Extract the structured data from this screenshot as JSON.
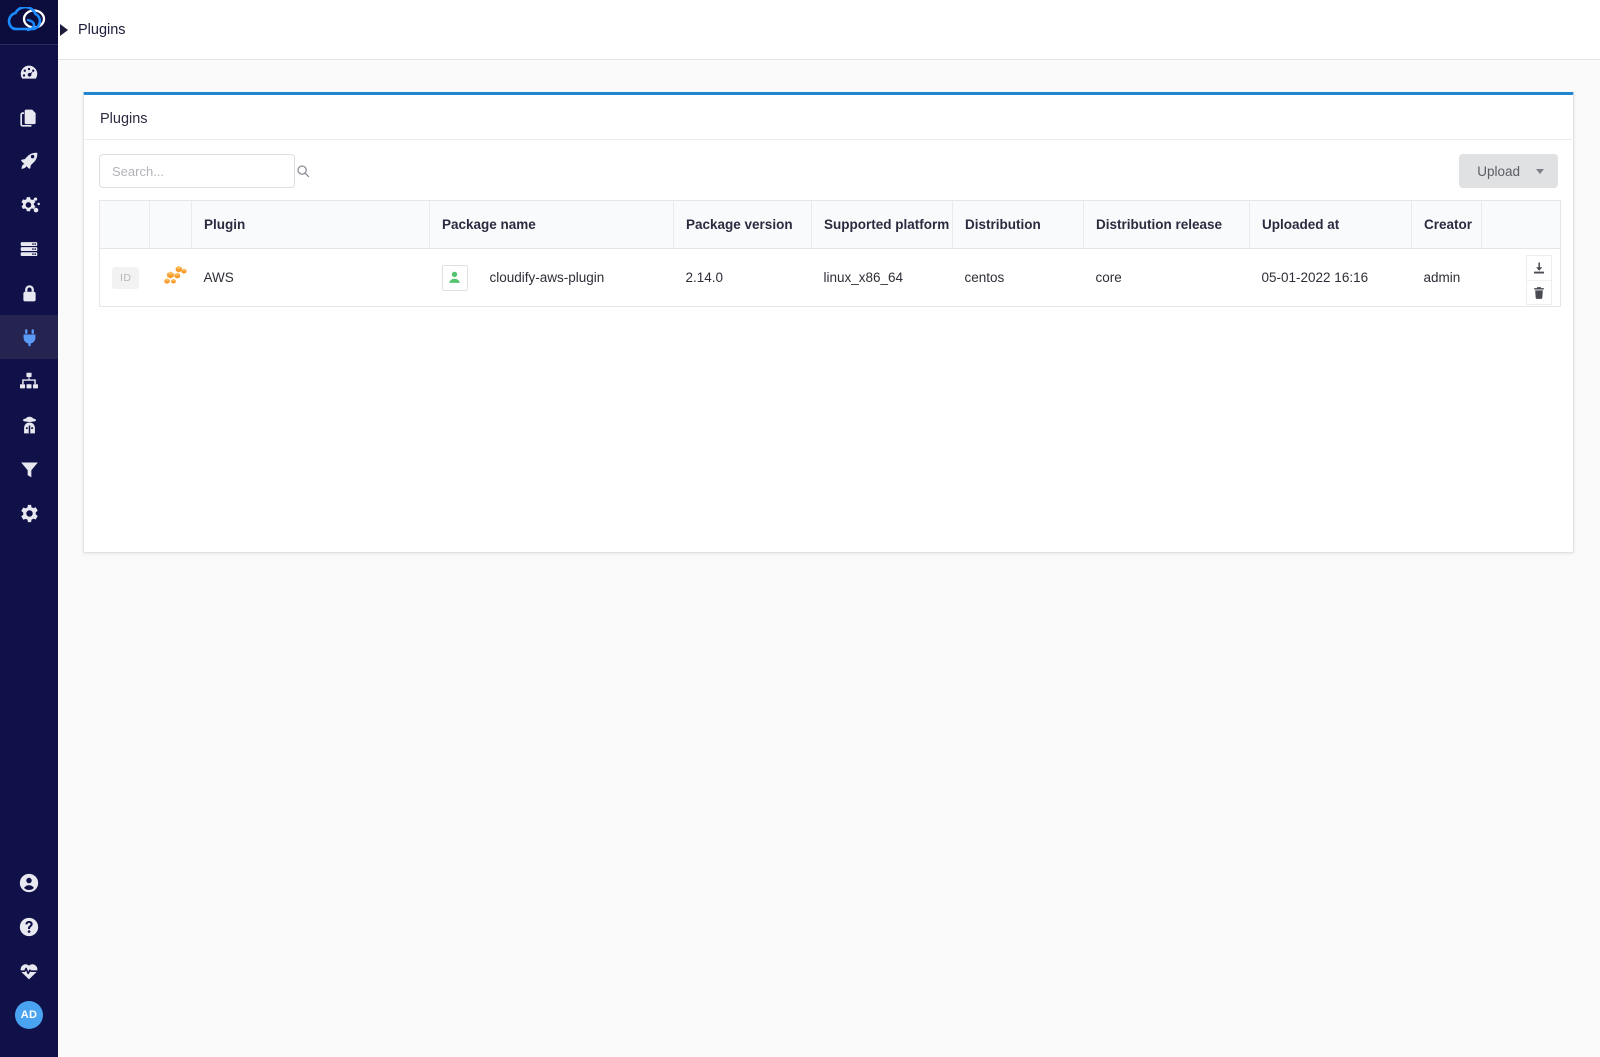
{
  "app": {
    "logo_icon": "cloudify-cloud-logo",
    "user_initials": "AD"
  },
  "sidebar": {
    "items": [
      {
        "icon": "dashboard-gauge-icon",
        "name": "dashboard",
        "active": false
      },
      {
        "icon": "blueprints-pages-icon",
        "name": "blueprints",
        "active": false
      },
      {
        "icon": "deployments-rocket-icon",
        "name": "deployments",
        "active": false
      },
      {
        "icon": "executions-gears-icon",
        "name": "executions",
        "active": false
      },
      {
        "icon": "system-resources-server-icon",
        "name": "system-resources",
        "active": false
      },
      {
        "icon": "secrets-lock-icon",
        "name": "secrets",
        "active": false
      },
      {
        "icon": "plugins-plug-icon",
        "name": "plugins",
        "active": true
      },
      {
        "icon": "sites-sitemap-icon",
        "name": "sites",
        "active": false
      },
      {
        "icon": "agents-detective-icon",
        "name": "agents",
        "active": false
      },
      {
        "icon": "filters-funnel-icon",
        "name": "filters",
        "active": false
      },
      {
        "icon": "settings-gear-icon",
        "name": "settings",
        "active": false
      }
    ],
    "bottom_items": [
      {
        "icon": "user-profile-icon",
        "name": "user-profile"
      },
      {
        "icon": "help-question-icon",
        "name": "help"
      },
      {
        "icon": "health-heartbeat-icon",
        "name": "system-health"
      }
    ]
  },
  "topbar": {
    "breadcrumb": "Plugins"
  },
  "card": {
    "title": "Plugins"
  },
  "search": {
    "placeholder": "Search...",
    "value": "",
    "icon": "search-icon"
  },
  "upload": {
    "label": "Upload",
    "caret_icon": "chevron-down-icon"
  },
  "table": {
    "columns": [
      {
        "label": "",
        "key": "id_chip"
      },
      {
        "label": "",
        "key": "plugin_icon"
      },
      {
        "label": "Plugin",
        "key": "plugin"
      },
      {
        "label": "Package name",
        "key": "package_name"
      },
      {
        "label": "Package version",
        "key": "package_version"
      },
      {
        "label": "Supported platform",
        "key": "supported_platform"
      },
      {
        "label": "Distribution",
        "key": "distribution"
      },
      {
        "label": "Distribution release",
        "key": "distribution_release"
      },
      {
        "label": "Uploaded at",
        "key": "uploaded_at"
      },
      {
        "label": "Creator",
        "key": "creator"
      },
      {
        "label": "",
        "key": "actions"
      }
    ],
    "rows": [
      {
        "id_chip": "ID",
        "plugin_icon": "aws-cubes-icon",
        "plugin": "AWS",
        "package_icon": "user-green-icon",
        "package_name": "cloudify-aws-plugin",
        "package_version": "2.14.0",
        "supported_platform": "linux_x86_64",
        "distribution": "centos",
        "distribution_release": "core",
        "uploaded_at": "05-01-2022 16:16",
        "creator": "admin",
        "actions": [
          "download-icon",
          "delete-trash-icon"
        ]
      }
    ]
  },
  "colors": {
    "sidebar_bg": "#11114a",
    "sidebar_active": "#252451",
    "accent_blue": "#2185d0",
    "avatar_blue": "#4aa3f0",
    "aws_orange": "#f0932b",
    "green_user": "#52c46f",
    "upload_button_bg": "#e0e1e2"
  }
}
